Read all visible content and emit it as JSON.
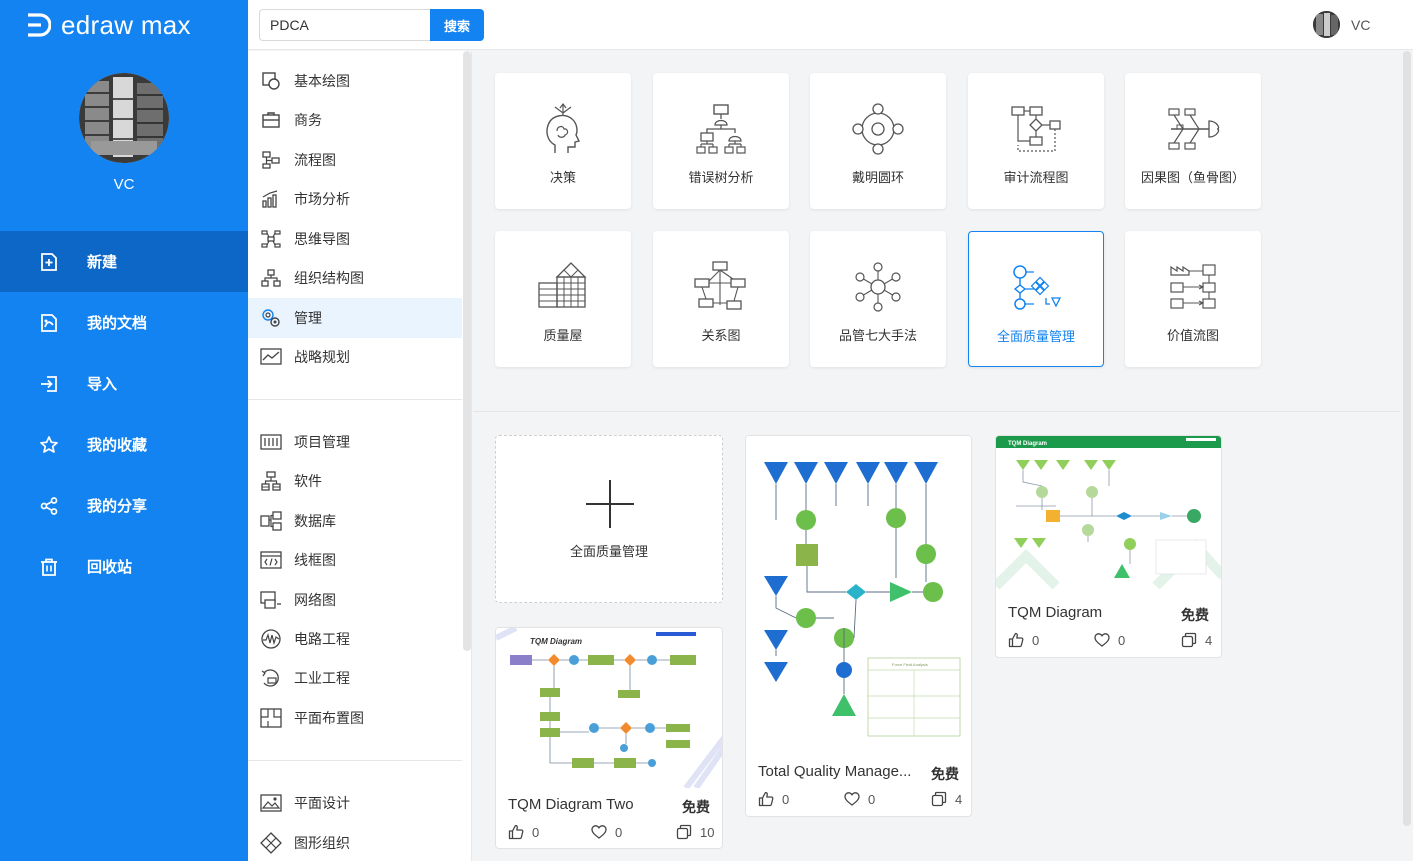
{
  "app": {
    "logo_text": "edraw max",
    "user_name": "VC"
  },
  "nav": {
    "items": [
      {
        "label": "新建",
        "icon": "new-file-icon"
      },
      {
        "label": "我的文档",
        "icon": "documents-icon"
      },
      {
        "label": "导入",
        "icon": "import-icon"
      },
      {
        "label": "我的收藏",
        "icon": "star-icon"
      },
      {
        "label": "我的分享",
        "icon": "share-icon"
      },
      {
        "label": "回收站",
        "icon": "trash-icon"
      }
    ]
  },
  "search": {
    "value": "PDCA",
    "button_label": "搜索"
  },
  "topbar": {
    "user_name": "VC"
  },
  "categories": {
    "group1": [
      "基本绘图",
      "商务",
      "流程图",
      "市场分析",
      "思维导图",
      "组织结构图",
      "管理",
      "战略规划"
    ],
    "group2": [
      "项目管理",
      "软件",
      "数据库",
      "线框图",
      "网络图",
      "电路工程",
      "工业工程",
      "平面布置图"
    ],
    "group3": [
      "平面设计",
      "图形组织"
    ],
    "active": "管理"
  },
  "subcategories": [
    {
      "label": "决策",
      "icon": "decision-head-icon"
    },
    {
      "label": "错误树分析",
      "icon": "fault-tree-icon"
    },
    {
      "label": "戴明圆环",
      "icon": "deming-cycle-icon"
    },
    {
      "label": "审计流程图",
      "icon": "audit-flowchart-icon"
    },
    {
      "label": "因果图（鱼骨图）",
      "icon": "fishbone-icon"
    },
    {
      "label": "质量屋",
      "icon": "house-of-quality-icon"
    },
    {
      "label": "关系图",
      "icon": "relation-diagram-icon"
    },
    {
      "label": "品管七大手法",
      "icon": "seven-tools-icon"
    },
    {
      "label": "全面质量管理",
      "icon": "tqm-icon"
    },
    {
      "label": "价值流图",
      "icon": "value-stream-icon"
    }
  ],
  "new_card": {
    "label": "全面质量管理"
  },
  "templates": [
    {
      "title": "TQM Diagram Two",
      "price": "免费",
      "likes": "0",
      "favorites": "0",
      "copies": "10"
    },
    {
      "title": "Total Quality Manage...",
      "price": "免费",
      "likes": "0",
      "favorites": "0",
      "copies": "4"
    },
    {
      "title": "TQM Diagram",
      "price": "免费",
      "likes": "0",
      "favorites": "0",
      "copies": "4"
    }
  ],
  "colors": {
    "primary": "#1283f1",
    "primary_dark": "#0c67c6"
  }
}
